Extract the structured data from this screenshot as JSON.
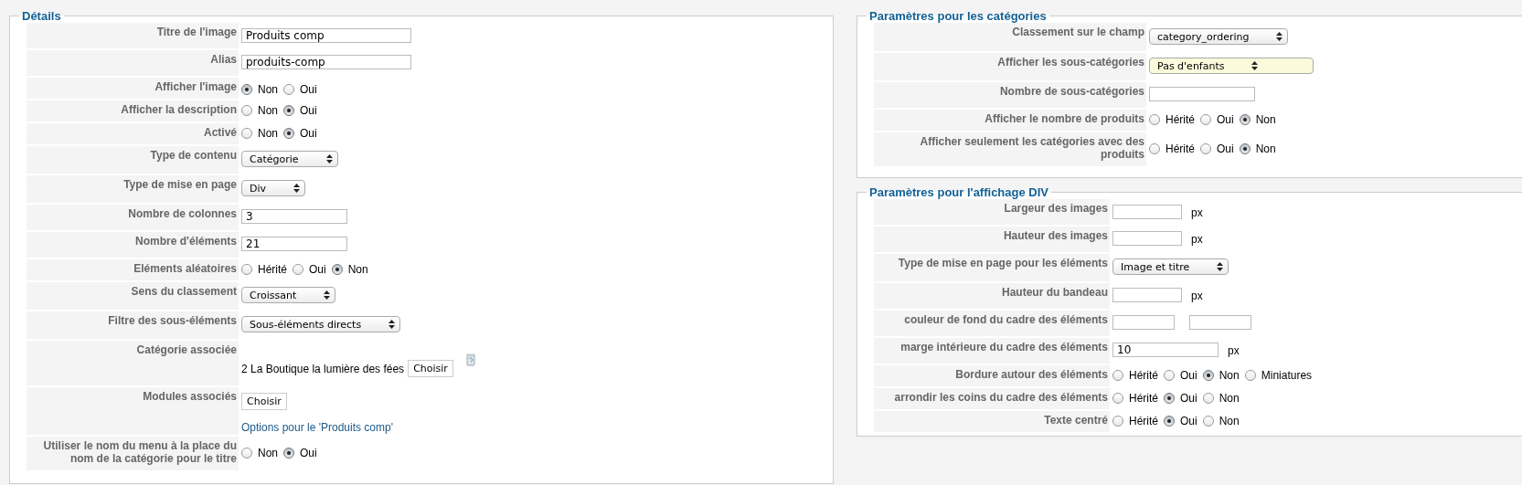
{
  "details": {
    "title": "Détails",
    "rows": [
      {
        "kind": "text",
        "label": "Titre de l'image",
        "value": "Produits comp"
      },
      {
        "kind": "text",
        "label": "Alias",
        "value": "produits-comp"
      },
      {
        "kind": "radio",
        "label": "Afficher l'image",
        "options": [
          {
            "label": "Non",
            "selected": true
          },
          {
            "label": "Oui",
            "selected": false
          }
        ]
      },
      {
        "kind": "radio",
        "label": "Afficher la description",
        "options": [
          {
            "label": "Non",
            "selected": false
          },
          {
            "label": "Oui",
            "selected": true
          }
        ]
      },
      {
        "kind": "radio",
        "label": "Activé",
        "options": [
          {
            "label": "Non",
            "selected": false
          },
          {
            "label": "Oui",
            "selected": true
          }
        ]
      },
      {
        "kind": "select",
        "label": "Type de contenu",
        "value": "Catégorie",
        "highlighted": false
      },
      {
        "kind": "select",
        "label": "Type de mise en page",
        "value": "Div",
        "highlighted": false
      },
      {
        "kind": "number",
        "label": "Nombre de colonnes",
        "value": "3"
      },
      {
        "kind": "number",
        "label": "Nombre d'éléments",
        "value": "21"
      },
      {
        "kind": "radio",
        "label": "Eléments aléatoires",
        "options": [
          {
            "label": "Hérité",
            "selected": false
          },
          {
            "label": "Oui",
            "selected": false
          },
          {
            "label": "Non",
            "selected": true
          }
        ]
      },
      {
        "kind": "select",
        "label": "Sens du classement",
        "value": "Croissant",
        "highlighted": false
      },
      {
        "kind": "select",
        "label": "Filtre des sous-éléments",
        "value": "Sous-éléments directs",
        "highlighted": false
      },
      {
        "kind": "chooser",
        "label": "Catégorie associée",
        "value": "2 La Boutique la lumière des fées",
        "button": "Choisir"
      },
      {
        "kind": "modules",
        "label": "Modules associés",
        "button": "Choisir",
        "link": "Options pour le 'Produits comp'"
      },
      {
        "kind": "radio",
        "label": "Utiliser le nom du menu à la place du nom de la catégorie pour le titre",
        "options": [
          {
            "label": "Non",
            "selected": false
          },
          {
            "label": "Oui",
            "selected": true
          }
        ]
      }
    ]
  },
  "category_settings": {
    "title": "Paramètres pour les catégories",
    "rows": [
      {
        "kind": "select",
        "label": "Classement sur le champ",
        "value": "category_ordering",
        "highlighted": false
      },
      {
        "kind": "select",
        "label": "Afficher les sous-catégories",
        "value": "Pas d'enfants",
        "highlighted": true
      },
      {
        "kind": "number",
        "label": "Nombre de sous-catégories"
      },
      {
        "kind": "radio",
        "label": "Afficher le nombre de produits",
        "options": [
          {
            "label": "Hérité",
            "selected": false
          },
          {
            "label": "Oui",
            "selected": false
          },
          {
            "label": "Non",
            "selected": true
          }
        ]
      },
      {
        "kind": "radio",
        "label": "Afficher seulement les catégories avec des produits",
        "options": [
          {
            "label": "Hérité",
            "selected": false
          },
          {
            "label": "Oui",
            "selected": false
          },
          {
            "label": "Non",
            "selected": true
          }
        ]
      }
    ]
  },
  "div_display_settings": {
    "title": "Paramètres pour l'affichage DIV",
    "rows": [
      {
        "kind": "px",
        "label": "Largeur des images",
        "unit": "px"
      },
      {
        "kind": "px",
        "label": "Hauteur des images",
        "unit": "px"
      },
      {
        "kind": "select",
        "label": "Type de mise en page pour les éléments",
        "value": "Image et titre",
        "highlighted": false
      },
      {
        "kind": "px",
        "label": "Hauteur du bandeau",
        "unit": "px"
      },
      {
        "kind": "colors",
        "label": "couleur de fond du cadre des éléments"
      },
      {
        "kind": "pxwide",
        "label": "marge intérieure du cadre des éléments",
        "value": "10",
        "unit": "px"
      },
      {
        "kind": "radio",
        "label": "Bordure autour des éléments",
        "options": [
          {
            "label": "Hérité",
            "selected": false
          },
          {
            "label": "Oui",
            "selected": false
          },
          {
            "label": "Non",
            "selected": true
          },
          {
            "label": "Miniatures",
            "selected": false
          }
        ]
      },
      {
        "kind": "radio",
        "label": "arrondir les coins du cadre des éléments",
        "options": [
          {
            "label": "Hérité",
            "selected": false
          },
          {
            "label": "Oui",
            "selected": true
          },
          {
            "label": "Non",
            "selected": false
          }
        ]
      },
      {
        "kind": "radio",
        "label": "Texte centré",
        "options": [
          {
            "label": "Hérité",
            "selected": false
          },
          {
            "label": "Oui",
            "selected": true
          },
          {
            "label": "Non",
            "selected": false
          }
        ]
      }
    ]
  }
}
